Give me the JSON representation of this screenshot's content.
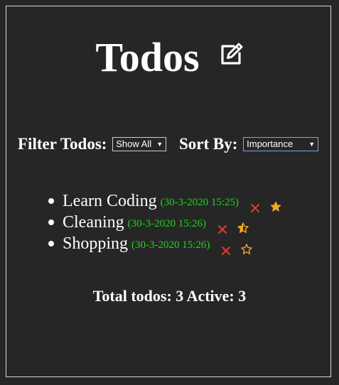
{
  "header": {
    "title": "Todos",
    "edit_icon": "edit-icon"
  },
  "filter": {
    "label": "Filter Todos:",
    "selected": "Show All"
  },
  "sort": {
    "label": "Sort By:",
    "selected": "Importance"
  },
  "todos": [
    {
      "text": "Learn Coding",
      "timestamp": "(30-3-2020 15:25)",
      "importance": "full",
      "importance_level": 1.0
    },
    {
      "text": "Cleaning",
      "timestamp": "(30-3-2020 15:26)",
      "importance": "half",
      "importance_level": 0.5
    },
    {
      "text": "Shopping",
      "timestamp": "(30-3-2020 15:26)",
      "importance": "empty",
      "importance_level": 0.0
    }
  ],
  "summary": {
    "text": "Total todos: 3 Active: 3"
  },
  "colors": {
    "background": "#262626",
    "timestamp": "#22d41b",
    "delete": "#e23b2e",
    "star": "#f5a623"
  }
}
